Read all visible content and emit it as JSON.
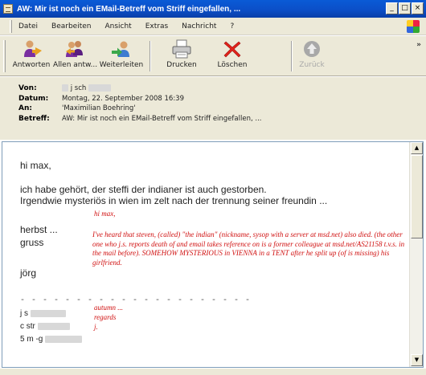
{
  "window": {
    "title": "AW: Mir ist noch ein EMail-Betreff vom Striff eingefallen, ...",
    "controls": [
      "_",
      "□",
      "×"
    ]
  },
  "menu": {
    "items": [
      "Datei",
      "Bearbeiten",
      "Ansicht",
      "Extras",
      "Nachricht",
      "?"
    ]
  },
  "toolbar": {
    "buttons": [
      {
        "label": "Antworten",
        "icon": "reply-icon",
        "enabled": true
      },
      {
        "label": "Allen antw...",
        "icon": "reply-all-icon",
        "enabled": true
      },
      {
        "label": "Weiterleiten",
        "icon": "forward-icon",
        "enabled": true
      },
      {
        "label": "Drucken",
        "icon": "printer-icon",
        "enabled": true
      },
      {
        "label": "Löschen",
        "icon": "delete-icon",
        "enabled": true
      },
      {
        "label": "Zurück",
        "icon": "back-arrow-icon",
        "enabled": false
      }
    ],
    "overflow": "»"
  },
  "header": {
    "from_label": "Von:",
    "from_value": "j     sch",
    "date_label": "Datum:",
    "date_value": "Montag, 22. September 2008 16:39",
    "to_label": "An:",
    "to_value": "'Maximilian Boehring'",
    "subject_label": "Betreff:",
    "subject_value": "AW: Mir ist noch ein EMail-Betreff vom Striff eingefallen, ..."
  },
  "message": {
    "greeting": "hi max,",
    "line1": "ich habe gehört, der steffi der indianer ist auch gestorben.",
    "line2": "Irgendwie mysteriös in wien im zelt nach der trennung seiner freundin ...",
    "closing1": "herbst ...",
    "closing2": "gruss",
    "signature": "jörg",
    "separator": "- - - - - - - - - - - - - - - - - - - - -",
    "contact1": "j    s",
    "contact2": "c          str",
    "contact3": "5        m      -g"
  },
  "annotations": {
    "greeting": "hi max,",
    "translation": "I've heard that steven, (called) \"the indian\" (nickname, sysop with a server at msd.net) also died. (the other one who j.s. reports death of and email takes reference on is a former colleague at msd.net/AS21158 t.v.s. in the mail before). SOMEHOW MYSTERIOUS in VIENNA in a TENT after he split up (of is missing) his girlfriend.",
    "closing1": "autumn ...",
    "closing2": "regards",
    "closing3": "j."
  },
  "scrollbar": {
    "up": "▲",
    "down": "▼"
  }
}
